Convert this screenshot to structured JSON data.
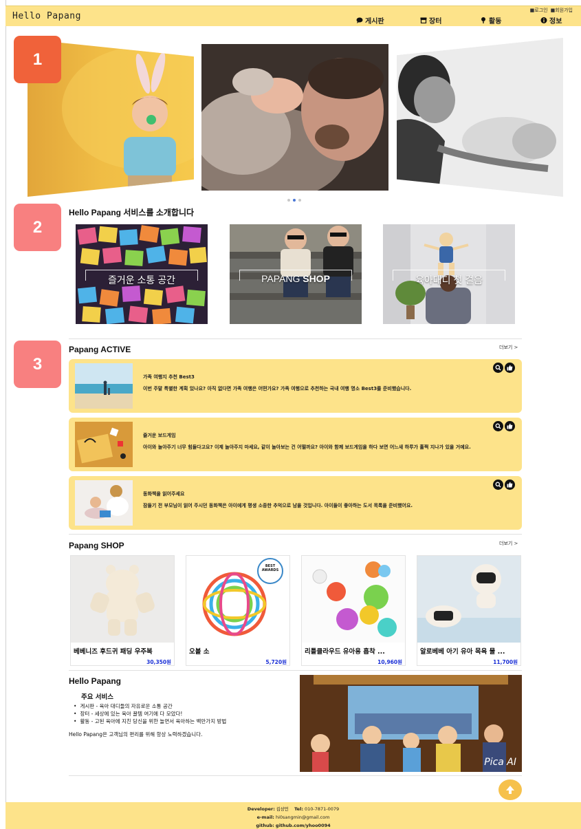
{
  "header": {
    "brand": "Hello Papang",
    "auth": {
      "login": "로그인",
      "signup": "회원가입"
    },
    "nav": [
      {
        "label": "게시판",
        "icon": "chat-bubble-icon"
      },
      {
        "label": "장터",
        "icon": "store-icon"
      },
      {
        "label": "활동",
        "icon": "pin-icon"
      },
      {
        "label": "정보",
        "icon": "info-icon"
      }
    ]
  },
  "badges": [
    "1",
    "2",
    "3"
  ],
  "carousel": {
    "active_index": 1,
    "count": 3
  },
  "services": {
    "title": "Hello Papang 서비스를 소개합니다",
    "cards": [
      {
        "label": "즐거운 소통 공간"
      },
      {
        "label_a": "PAPANG ",
        "label_b": "SHOP"
      },
      {
        "label": "육아대디 첫 걸음"
      }
    ]
  },
  "active": {
    "title": "Papang ACTIVE",
    "more": "더보기 >",
    "items": [
      {
        "title": "가족 여행지 추천 Best3",
        "desc": "이번 주말 특별한 계획 있나요? 아직 없다면 가족 여행은 어떤가요? 가족 여행으로 추천하는 국내 여행 명소 Best3를 준비했습니다."
      },
      {
        "title": "즐거운 보드게임",
        "desc": "아이와 놀아주기 너무 힘들다고요? 이제 놀아주지 마세요, 같이 놀아보는 건 어떨까요? 아이와 함께 보드게임을 하다 보면 어느새 하루가 훌쩍 지나가 있을 거예요."
      },
      {
        "title": "동화책을 읽어주세요",
        "desc": "잠들기 전 부모님이 읽어 주시던 동화책은 아이에게 평생 소중한 추억으로 남을 것입니다. 아이들이 좋아하는 도서 목록을 준비했어요."
      }
    ]
  },
  "shop": {
    "title": "Papang SHOP",
    "more": "더보기 >",
    "products": [
      {
        "name": "베베니즈 후드귀 패딩 우주복",
        "price": "30,350원"
      },
      {
        "name": "오볼 소",
        "price": "5,720원"
      },
      {
        "name": "리틀클라우드 유아용 흡착 ...",
        "price": "10,960원"
      },
      {
        "name": "알로베베 아기 유아 목욕 물 ...",
        "price": "11,700원"
      }
    ],
    "award_badge": {
      "line1": "BEST",
      "line2": "AWARDS"
    }
  },
  "about": {
    "title": "Hello Papang",
    "subtitle": "주요 서비스",
    "list": [
      "게시판 - 육아 대디들의 자유로운 소통 공간",
      "장터 - 세상에 있는 육아 꿀템 여기에 다 모았다!",
      "활동 - 고된 육아에 지친 당신을 위한 놀면서 육아하는 백만가지 방법"
    ],
    "note": "Hello Papang은 고객님의 편리를 위해 항상 노력하겠습니다.",
    "image_watermark": "Pica AI"
  },
  "footer": {
    "developer_label": "Developer:",
    "developer": "김상민",
    "tel_label": "Tel:",
    "tel": "010-7871-0079",
    "email_label": "e-mail:",
    "email": "hi0sangmin@gmail.com",
    "github_label": "github:",
    "github": "github.com/yhoo0094"
  },
  "colors": {
    "header_bg": "#fde38a",
    "card_bg": "#fde38a",
    "price": "#1a2fd6",
    "badge_1": "#f0623a",
    "badge_2_3": "#f88080",
    "dot_active": "#4a76d6"
  }
}
